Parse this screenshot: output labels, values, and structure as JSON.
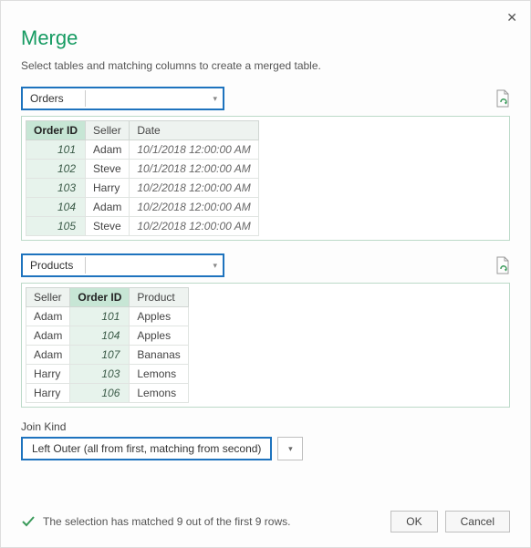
{
  "title": "Merge",
  "subtitle": "Select tables and matching columns to create a merged table.",
  "table1": {
    "name": "Orders",
    "columns": [
      {
        "label": "Order ID",
        "selected": true
      },
      {
        "label": "Seller",
        "selected": false
      },
      {
        "label": "Date",
        "selected": false
      }
    ],
    "rows": [
      {
        "id": "101",
        "seller": "Adam",
        "date": "10/1/2018 12:00:00 AM"
      },
      {
        "id": "102",
        "seller": "Steve",
        "date": "10/1/2018 12:00:00 AM"
      },
      {
        "id": "103",
        "seller": "Harry",
        "date": "10/2/2018 12:00:00 AM"
      },
      {
        "id": "104",
        "seller": "Adam",
        "date": "10/2/2018 12:00:00 AM"
      },
      {
        "id": "105",
        "seller": "Steve",
        "date": "10/2/2018 12:00:00 AM"
      }
    ]
  },
  "table2": {
    "name": "Products",
    "columns": [
      {
        "label": "Seller",
        "selected": false
      },
      {
        "label": "Order ID",
        "selected": true
      },
      {
        "label": "Product",
        "selected": false
      }
    ],
    "rows": [
      {
        "seller": "Adam",
        "id": "101",
        "product": "Apples"
      },
      {
        "seller": "Adam",
        "id": "104",
        "product": "Apples"
      },
      {
        "seller": "Adam",
        "id": "107",
        "product": "Bananas"
      },
      {
        "seller": "Harry",
        "id": "103",
        "product": "Lemons"
      },
      {
        "seller": "Harry",
        "id": "106",
        "product": "Lemons"
      }
    ]
  },
  "join": {
    "label": "Join Kind",
    "value": "Left Outer (all from first, matching from second)"
  },
  "status": "The selection has matched 9 out of the first 9 rows.",
  "buttons": {
    "ok": "OK",
    "cancel": "Cancel"
  }
}
